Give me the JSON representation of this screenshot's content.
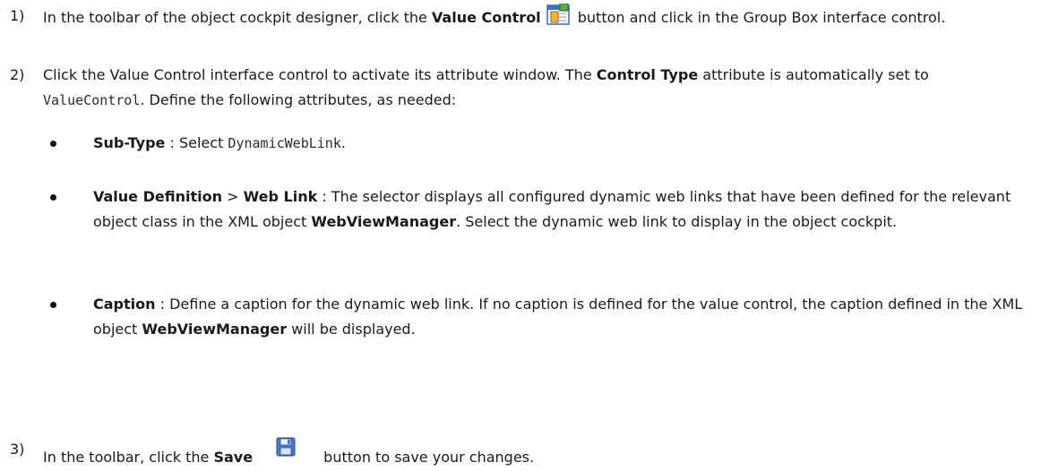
{
  "steps": [
    {
      "number": "1)",
      "parts": [
        "In the toolbar of the object cockpit designer, click the ",
        "Value Control",
        " button and click in the Group Box interface control."
      ],
      "icon": "value-control-icon"
    },
    {
      "number": "2)",
      "parts": [
        "Click the Value Control interface control to activate its attribute window. The ",
        "Control Type",
        " attribute is automatically set to ",
        "ValueControl",
        ". Define the following attributes, as needed:"
      ]
    },
    {
      "number": "3)",
      "parts": [
        "In the toolbar, click the ",
        "Save",
        " button to save your changes."
      ],
      "icon": "save-icon"
    }
  ],
  "bullets": [
    {
      "parts": [
        "Sub-Type",
        " : Select ",
        "DynamicWebLink",
        "."
      ]
    },
    {
      "parts": [
        "Value Definition",
        " > ",
        "Web Link",
        " : The selector displays all configured dynamic web links that have been defined for the relevant object class in the XML object ",
        "WebViewManager",
        ". Select the dynamic web link to display in the object cockpit."
      ]
    },
    {
      "parts": [
        "Caption",
        " : Define a caption for the dynamic web link. If no caption is defined for the value control, the caption defined in the XML object ",
        "WebViewManager",
        " will be displayed."
      ]
    }
  ],
  "colors": {
    "text": "#1a1a1a",
    "bullet": "#111111",
    "icon_blue": "#3d6fc6",
    "icon_gold": "#e8b43a"
  }
}
